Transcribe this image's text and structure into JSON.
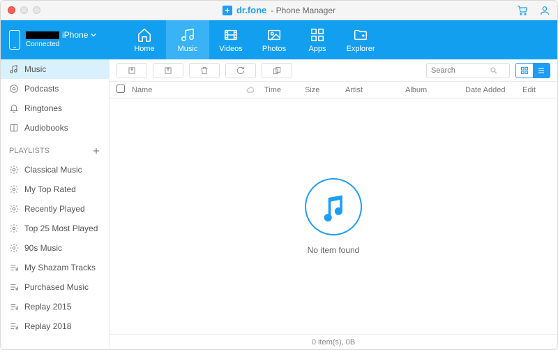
{
  "titlebar": {
    "brand": "dr.fone",
    "subtitle": "- Phone Manager"
  },
  "device": {
    "name_suffix": "iPhone",
    "status": "Connected"
  },
  "nav": {
    "home": "Home",
    "music": "Music",
    "videos": "Videos",
    "photos": "Photos",
    "apps": "Apps",
    "explorer": "Explorer"
  },
  "sidebar": {
    "library": {
      "music": "Music",
      "podcasts": "Podcasts",
      "ringtones": "Ringtones",
      "audiobooks": "Audiobooks"
    },
    "playlists_header": "PLAYLISTS",
    "playlists": {
      "p0": "Classical Music",
      "p1": "My Top Rated",
      "p2": "Recently Played",
      "p3": "Top 25 Most Played",
      "p4": "90s Music",
      "p5": "My Shazam Tracks",
      "p6": "Purchased Music",
      "p7": "Replay 2015",
      "p8": "Replay 2018"
    }
  },
  "search": {
    "placeholder": "Search"
  },
  "columns": {
    "name": "Name",
    "time": "Time",
    "size": "Size",
    "artist": "Artist",
    "album": "Album",
    "date_added": "Date Added",
    "edit": "Edit"
  },
  "empty": {
    "message": "No item found"
  },
  "status": {
    "text": "0 item(s), 0B"
  }
}
